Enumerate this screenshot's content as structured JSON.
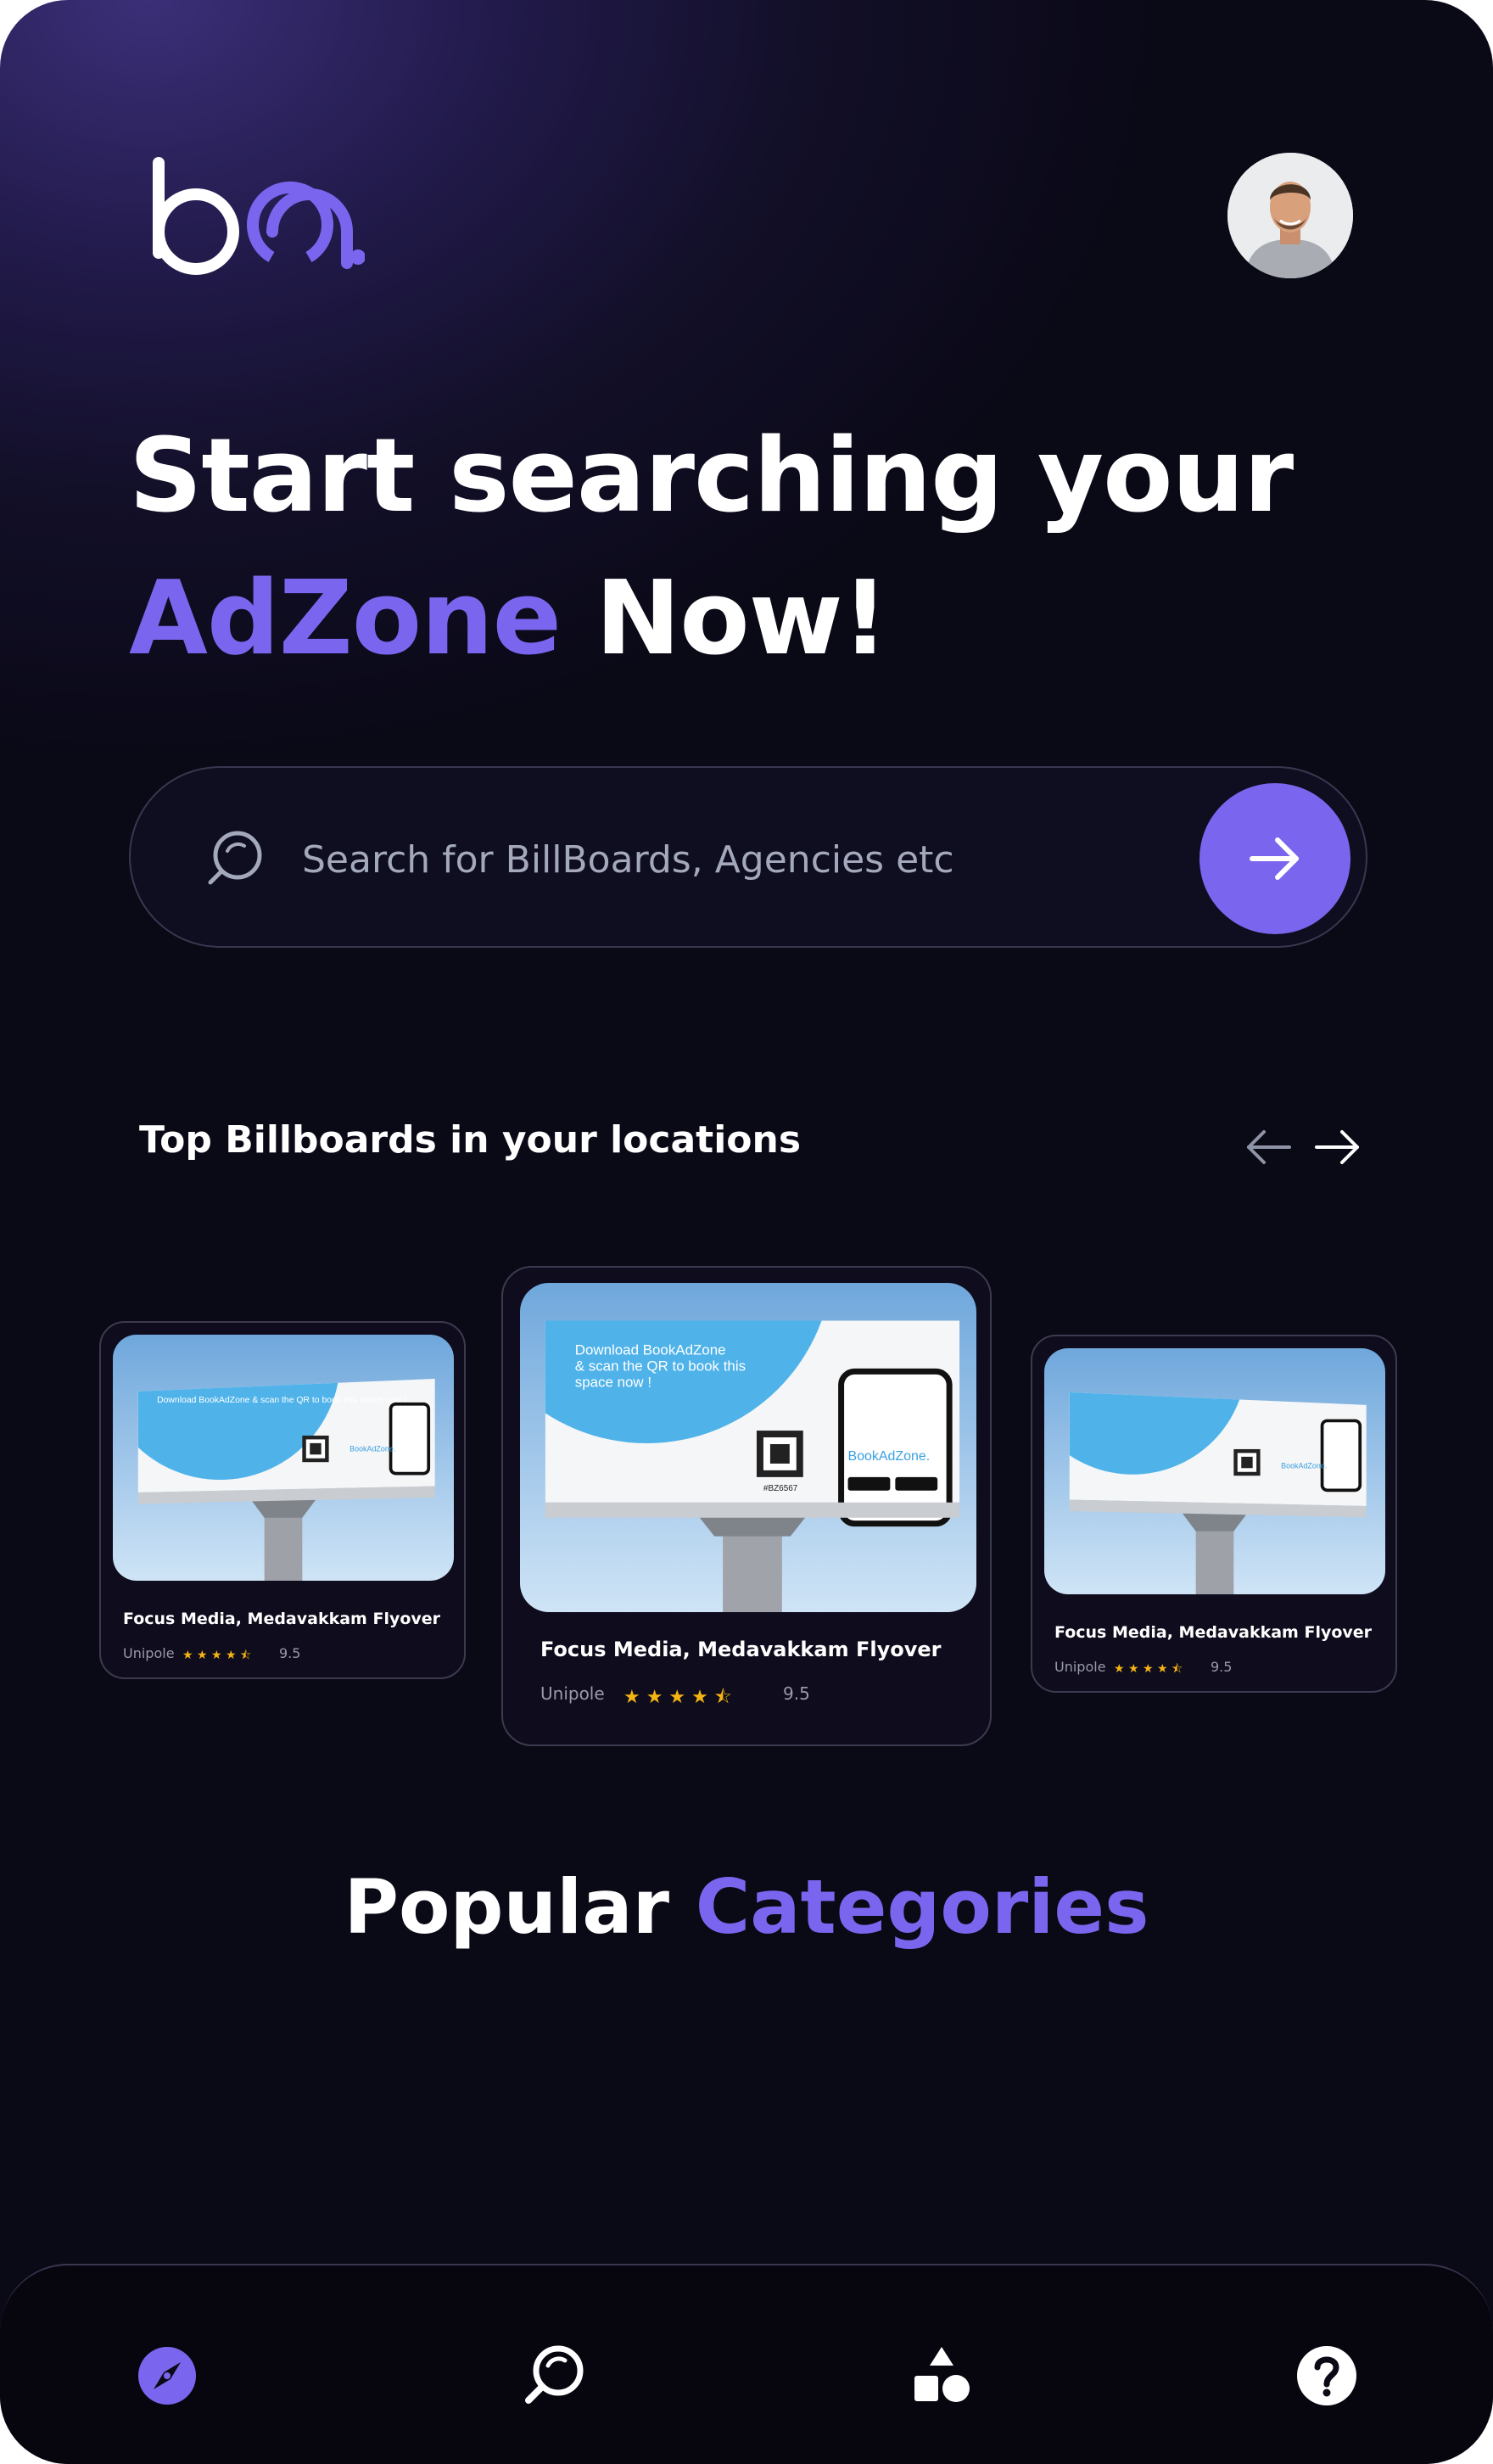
{
  "logo": {
    "text": "ba.",
    "color_primary": "#ffffff",
    "color_accent": "#7a66ee"
  },
  "user": {
    "avatar": "profile-photo"
  },
  "hero": {
    "line1": "Start searching your",
    "accent": "AdZone",
    "rest": " Now!"
  },
  "search": {
    "placeholder": "Search for BillBoards, Agencies etc",
    "value": "",
    "button_icon": "arrow-right-icon"
  },
  "top_section": {
    "title": "Top Billboards in your locations",
    "prev_icon": "arrow-left-icon",
    "next_icon": "arrow-right-icon"
  },
  "billboard_ad": {
    "headline": "Download BookAdZone & scan the QR to book this space now !",
    "brand": "BookAdZone.",
    "code": "#BZ6567"
  },
  "cards": [
    {
      "title": "Focus Media, Medavakkam Flyover",
      "type": "Unipole",
      "stars": "★ ★ ★ ★ ⯪",
      "rating": "9.5"
    },
    {
      "title": "Focus Media, Medavakkam Flyover",
      "type": "Unipole",
      "stars": "★ ★ ★ ★ ⯪",
      "rating": "9.5"
    },
    {
      "title": "Focus Media, Medavakkam Flyover",
      "type": "Unipole",
      "stars": "★ ★ ★ ★ ⯪",
      "rating": "9.5"
    }
  ],
  "popular": {
    "word1": "Popular",
    "word2": "Categories"
  },
  "nav": {
    "items": [
      {
        "icon": "compass-icon",
        "active": true
      },
      {
        "icon": "search-icon",
        "active": false
      },
      {
        "icon": "categories-icon",
        "active": false
      },
      {
        "icon": "help-icon",
        "active": false
      }
    ]
  },
  "colors": {
    "accent": "#7a66ee",
    "star": "#f5b413",
    "sky": "#9fc9ee"
  }
}
